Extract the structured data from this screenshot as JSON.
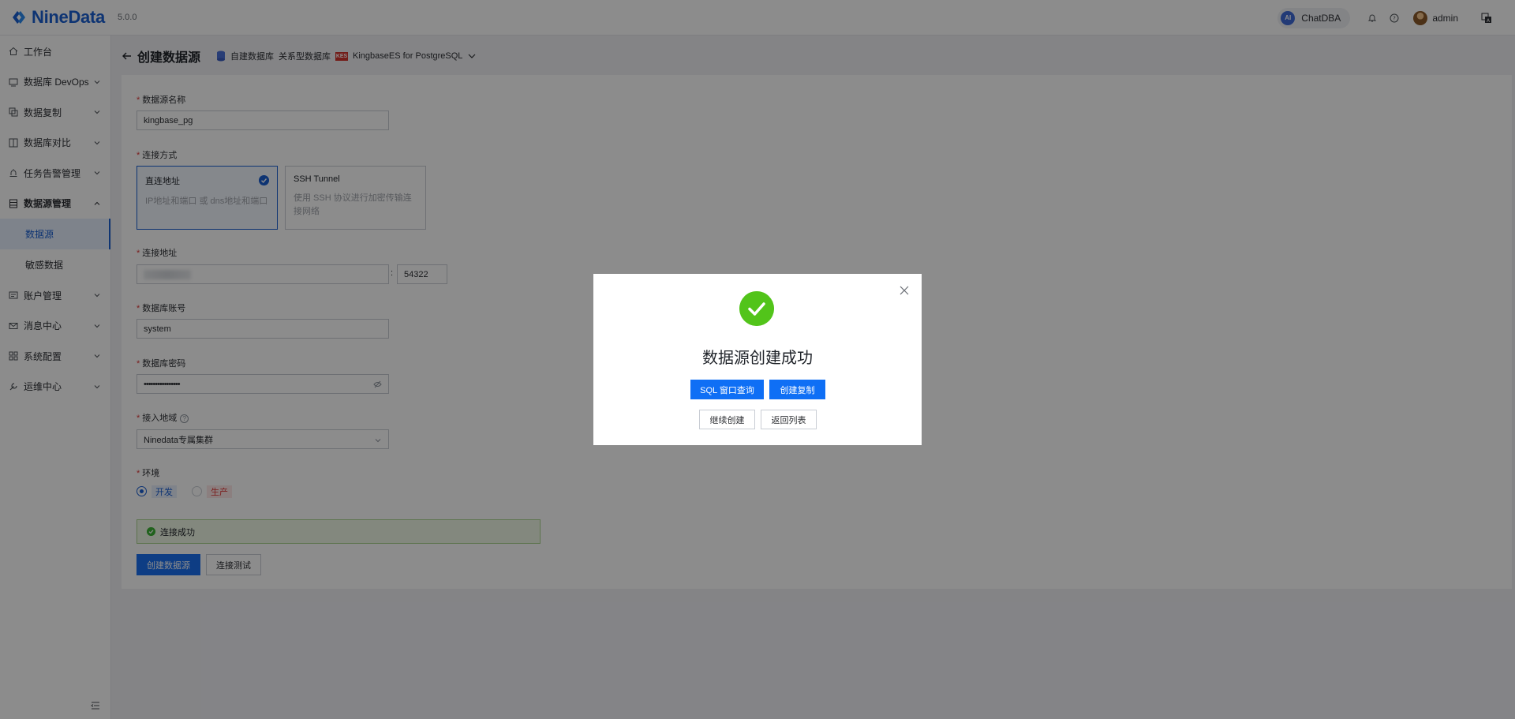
{
  "app": {
    "brand": "NineData",
    "version": "5.0.0"
  },
  "topbar": {
    "chat_badge": "AI",
    "chat_label": "ChatDBA",
    "username": "admin"
  },
  "sidebar": {
    "items": [
      {
        "label": "工作台",
        "icon": "home-icon"
      },
      {
        "label": "数据库 DevOps",
        "icon": "devops-icon"
      },
      {
        "label": "数据复制",
        "icon": "replication-icon"
      },
      {
        "label": "数据库对比",
        "icon": "compare-icon"
      },
      {
        "label": "任务告警管理",
        "icon": "alarm-icon"
      },
      {
        "label": "数据源管理",
        "icon": "datasource-icon"
      }
    ],
    "sub_items": [
      {
        "label": "数据源"
      },
      {
        "label": "敏感数据"
      }
    ],
    "items_after": [
      {
        "label": "账户管理",
        "icon": "account-icon"
      },
      {
        "label": "消息中心",
        "icon": "message-icon"
      },
      {
        "label": "系统配置",
        "icon": "settings-icon"
      },
      {
        "label": "运维中心",
        "icon": "ops-icon"
      }
    ]
  },
  "header": {
    "title": "创建数据源",
    "crumb_1": "自建数据库",
    "crumb_2": "关系型数据库",
    "db_logo_text": "KES",
    "db_type": "KingbaseES for PostgreSQL"
  },
  "form": {
    "name_label": "数据源名称",
    "name_value": "kingbase_pg",
    "conn_method_label": "连接方式",
    "card_direct_title": "直连地址",
    "card_direct_desc": "IP地址和端口 或 dns地址和端口",
    "card_ssh_title": "SSH Tunnel",
    "card_ssh_desc": "使用 SSH 协议进行加密传输连接网络",
    "addr_label": "连接地址",
    "addr_sep": ":",
    "port_value": "54322",
    "account_label": "数据库账号",
    "account_value": "system",
    "password_label": "数据库密码",
    "password_value": "••••••••••••••••",
    "region_label": "接入地域",
    "region_value": "Ninedata专属集群",
    "env_label": "环境",
    "env_options": [
      "开发",
      "生产"
    ],
    "env_selected": "开发",
    "success_text": "连接成功",
    "create_button": "创建数据源",
    "test_button": "连接测试"
  },
  "modal": {
    "title": "数据源创建成功",
    "btn_sql": "SQL 窗口查询",
    "btn_replicate": "创建复制",
    "btn_continue": "继续创建",
    "btn_back": "返回列表"
  },
  "colors": {
    "brand": "#1a5fd1",
    "primary_button": "#1a6ff0",
    "success": "#52c41a",
    "required": "#e03a3a"
  }
}
